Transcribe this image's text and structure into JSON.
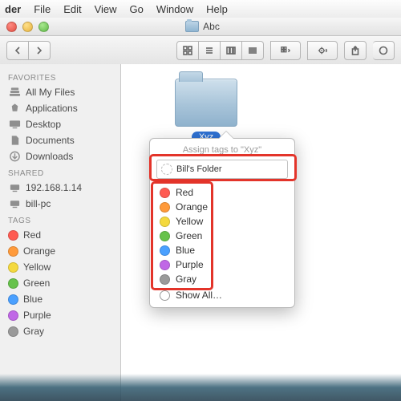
{
  "menubar": {
    "items": [
      "der",
      "File",
      "Edit",
      "View",
      "Go",
      "Window",
      "Help"
    ]
  },
  "window": {
    "title": "Abc"
  },
  "sidebar": {
    "favorites": {
      "head": "Favorites",
      "items": [
        {
          "name": "all-my-files",
          "label": "All My Files"
        },
        {
          "name": "applications",
          "label": "Applications"
        },
        {
          "name": "desktop",
          "label": "Desktop"
        },
        {
          "name": "documents",
          "label": "Documents"
        },
        {
          "name": "downloads",
          "label": "Downloads"
        }
      ]
    },
    "shared": {
      "head": "Shared",
      "items": [
        {
          "name": "shared-ip",
          "label": "192.168.1.14"
        },
        {
          "name": "shared-bill-pc",
          "label": "bill-pc"
        }
      ]
    },
    "tags": {
      "head": "Tags",
      "items": [
        {
          "label": "Red",
          "color": "#ff5b52"
        },
        {
          "label": "Orange",
          "color": "#ff9a3a"
        },
        {
          "label": "Yellow",
          "color": "#f4d93e"
        },
        {
          "label": "Green",
          "color": "#66c24b"
        },
        {
          "label": "Blue",
          "color": "#4aa0ff"
        },
        {
          "label": "Purple",
          "color": "#c067e6"
        },
        {
          "label": "Gray",
          "color": "#9a9a9a"
        }
      ]
    }
  },
  "content": {
    "folder_name": "Xyz"
  },
  "popover": {
    "title": "Assign tags to \"Xyz\"",
    "input_value": "Bill's Folder",
    "tags": [
      {
        "label": "Red",
        "color": "#ff5b52"
      },
      {
        "label": "Orange",
        "color": "#ff9a3a"
      },
      {
        "label": "Yellow",
        "color": "#f4d93e"
      },
      {
        "label": "Green",
        "color": "#66c24b"
      },
      {
        "label": "Blue",
        "color": "#4aa0ff"
      },
      {
        "label": "Purple",
        "color": "#c067e6"
      },
      {
        "label": "Gray",
        "color": "#9a9a9a"
      }
    ],
    "show_all": "Show All…"
  },
  "colors": {
    "accent": "#2f72d4"
  }
}
